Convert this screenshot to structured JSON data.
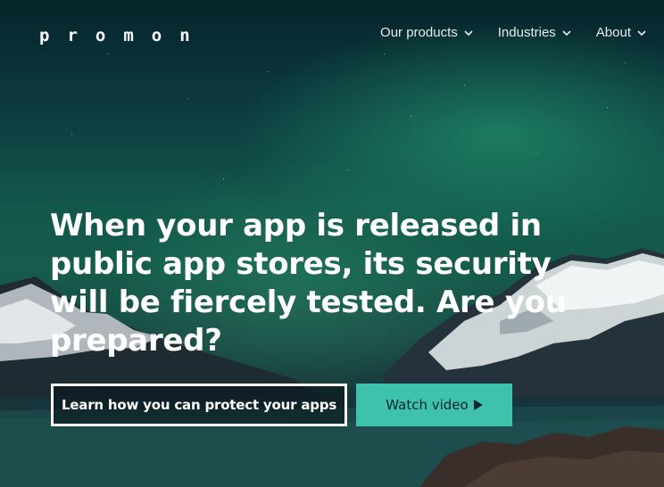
{
  "brand": {
    "logo_text": "promon"
  },
  "nav": {
    "items": [
      {
        "label": "Our products"
      },
      {
        "label": "Industries"
      },
      {
        "label": "About"
      }
    ]
  },
  "hero": {
    "headline": "When your app is released in public app stores, its security will be fiercely tested. Are you prepared?",
    "primary_cta": "Learn how you can protect your apps",
    "secondary_cta": "Watch video"
  },
  "colors": {
    "accent": "#3fc2ab",
    "text": "#ffffff"
  },
  "icons": [
    "chevron-down-icon",
    "play-icon"
  ]
}
